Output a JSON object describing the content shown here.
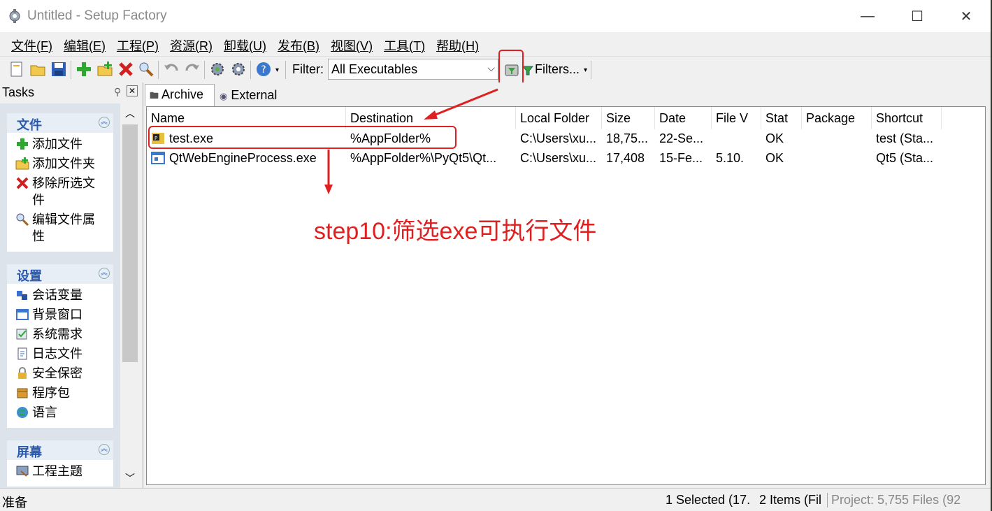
{
  "window": {
    "title": "Untitled - Setup Factory",
    "minimize": "—",
    "maximize": "☐",
    "close": "✕"
  },
  "menu": [
    {
      "label": "文件(",
      "key": "F",
      "end": ")"
    },
    {
      "label": "编辑(",
      "key": "E",
      "end": ")"
    },
    {
      "label": "工程(",
      "key": "P",
      "end": ")"
    },
    {
      "label": "资源(",
      "key": "R",
      "end": ")"
    },
    {
      "label": "卸载(",
      "key": "U",
      "end": ")"
    },
    {
      "label": "发布(",
      "key": "B",
      "end": ")"
    },
    {
      "label": "视图(",
      "key": "V",
      "end": ")"
    },
    {
      "label": "工具(",
      "key": "T",
      "end": ")"
    },
    {
      "label": "帮助(",
      "key": "H",
      "end": ")"
    }
  ],
  "toolbar": {
    "filter_label": "Filter:",
    "filter_value": "All Executables",
    "filters_button": "Filters...",
    "icons": [
      "new-project-icon",
      "open-project-icon",
      "save-icon",
      "add-files-icon",
      "add-folder-icon",
      "remove-icon",
      "search-icon",
      "undo-icon",
      "redo-icon",
      "build-icon",
      "publish-icon",
      "help-icon"
    ]
  },
  "tasks": {
    "title": "Tasks",
    "groups": [
      {
        "title": "文件",
        "items": [
          "添加文件",
          "添加文件夹",
          "移除所选文件",
          "编辑文件属性"
        ]
      },
      {
        "title": "设置",
        "items": [
          "会话变量",
          "背景窗口",
          "系统需求",
          "日志文件",
          "安全保密",
          "程序包",
          "语言"
        ]
      },
      {
        "title": "屏幕",
        "items": [
          "工程主题"
        ]
      }
    ]
  },
  "tabs": [
    {
      "label": "Archive",
      "active": true
    },
    {
      "label": "External",
      "active": false
    }
  ],
  "table": {
    "columns": [
      "Name",
      "Destination",
      "Local Folder",
      "Size",
      "Date",
      "File V",
      "Stat",
      "Package",
      "Shortcut"
    ],
    "rows": [
      {
        "name": "test.exe",
        "destination": "%AppFolder%",
        "local_folder": "C:\\Users\\xu...",
        "size": "18,75...",
        "date": "22-Se...",
        "file_version": "",
        "status": "OK",
        "package": "",
        "shortcut": "test (Sta..."
      },
      {
        "name": "QtWebEngineProcess.exe",
        "destination": "%AppFolder%\\PyQt5\\Qt...",
        "local_folder": "C:\\Users\\xu...",
        "size": "17,408",
        "date": "15-Fe...",
        "file_version": "5.10.",
        "status": "OK",
        "package": "",
        "shortcut": "Qt5 (Sta..."
      }
    ]
  },
  "annotation": {
    "text": "step10:筛选exe可执行文件",
    "color": "#e02020"
  },
  "status": {
    "left": "准备",
    "selected": "1 Selected (17.",
    "items": "2 Items (Fil",
    "project": "Project: 5,755 Files (92"
  }
}
